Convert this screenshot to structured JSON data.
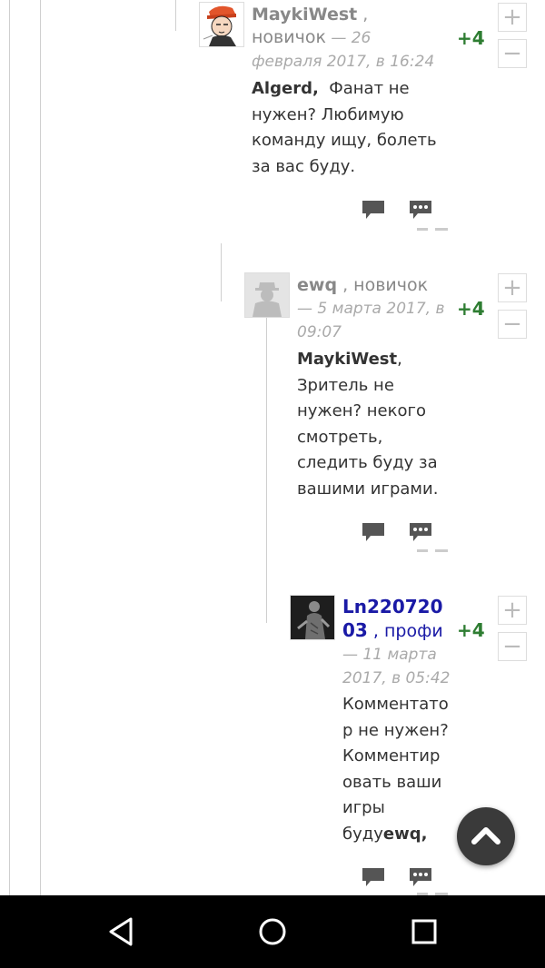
{
  "comments": [
    {
      "author": "MaykiWest",
      "sep": " ,",
      "role": "новичок",
      "date_prefix": " — 26",
      "date_rest": "февраля 2017, в 16:24",
      "score": "+4",
      "mention": "Algerd,",
      "text_lines": [
        "Фанат не",
        "нужен? Любимую",
        "команду ищу, болеть",
        "за вас буду."
      ]
    },
    {
      "author": "ewq",
      "sep": " , ",
      "role": "новичок",
      "date_line1": " — 5 марта 2017, в",
      "date_line2": "09:07",
      "score": "+4",
      "mention": "MaykiWest",
      "mention_suffix": ",",
      "text_lines": [
        "Зритель не",
        "нужен? некого",
        "смотреть,",
        "следить буду за",
        "вашими играми."
      ]
    },
    {
      "author_line1": "Ln220720",
      "author_line2": "03",
      "sep": " , ",
      "role": "профи",
      "date_line1": " — 11 марта",
      "date_line2": "2017, в 05:42",
      "score": "+4",
      "text_lines": [
        "Комментато",
        "р не нужен?",
        "Комментир",
        "овать ваши",
        "игры"
      ],
      "last_line_prefix": "буду",
      "mention": "ewq,"
    }
  ],
  "vote": {
    "plus": "+",
    "minus": "−"
  },
  "colors": {
    "score": "#2e7d32",
    "pro_author": "#1a1aa6",
    "icon": "#555555"
  },
  "icons": [
    "reply-icon",
    "quote-icon",
    "chevron-up-icon",
    "back-icon",
    "home-icon",
    "recents-icon"
  ]
}
